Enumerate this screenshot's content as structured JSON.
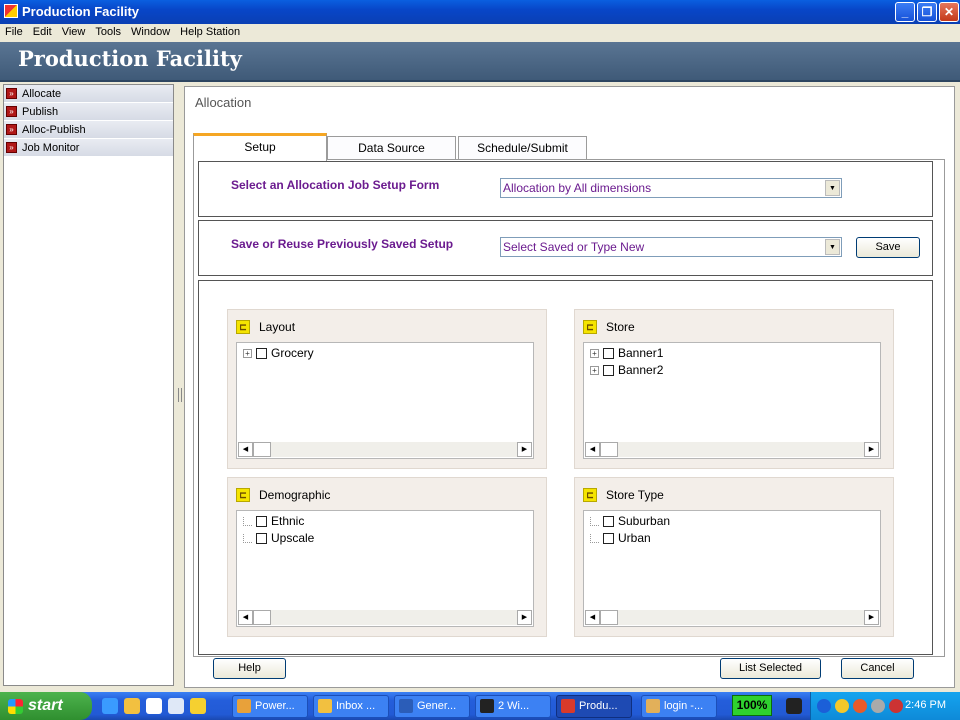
{
  "window": {
    "title": "Production Facility"
  },
  "menu": [
    "File",
    "Edit",
    "View",
    "Tools",
    "Window",
    "Help Station"
  ],
  "banner": {
    "title": "Production Facility"
  },
  "sidebar": {
    "items": [
      {
        "label": "Allocate"
      },
      {
        "label": "Publish"
      },
      {
        "label": "Alloc-Publish"
      },
      {
        "label": "Job Monitor"
      }
    ]
  },
  "main": {
    "title": "Allocation",
    "tabs": [
      {
        "label": "Setup",
        "active": true
      },
      {
        "label": "Data Source",
        "active": false
      },
      {
        "label": "Schedule/Submit",
        "active": false
      }
    ],
    "job_setup": {
      "label": "Select an Allocation Job Setup Form",
      "value": "Allocation by All dimensions"
    },
    "saved_setup": {
      "label": "Save or Reuse Previously Saved Setup",
      "value": "Select Saved or Type New",
      "save_label": "Save"
    },
    "dimensions": [
      {
        "title": "Layout",
        "items": [
          {
            "label": "Grocery",
            "expandable": true
          }
        ]
      },
      {
        "title": "Store",
        "items": [
          {
            "label": "Banner1",
            "expandable": true
          },
          {
            "label": "Banner2",
            "expandable": true
          }
        ]
      },
      {
        "title": "Demographic",
        "items": [
          {
            "label": "Ethnic",
            "expandable": false
          },
          {
            "label": "Upscale",
            "expandable": false
          }
        ]
      },
      {
        "title": "Store Type",
        "items": [
          {
            "label": "Suburban",
            "expandable": false
          },
          {
            "label": "Urban",
            "expandable": false
          }
        ]
      }
    ],
    "buttons": {
      "help": "Help",
      "list_selected": "List Selected",
      "cancel": "Cancel"
    }
  },
  "taskbar": {
    "start_label": "start",
    "tasks": [
      {
        "label": "Power...",
        "active": false,
        "icon_color": "#e8a13a"
      },
      {
        "label": "Inbox ...",
        "active": false,
        "icon_color": "#f2c040"
      },
      {
        "label": "Gener...",
        "active": false,
        "icon_color": "#2b5db8"
      },
      {
        "label": "2 Wi...",
        "active": false,
        "icon_color": "#222222"
      },
      {
        "label": "Produ...",
        "active": true,
        "icon_color": "#d83a2a"
      },
      {
        "label": "login -...",
        "active": false,
        "icon_color": "#e2b05a"
      }
    ],
    "zoom": "100%",
    "clock": "2:46 PM"
  },
  "colors": {
    "accent_label": "#6b1b8f",
    "active_tab": "#f5a623",
    "banner": "#4a6584"
  }
}
